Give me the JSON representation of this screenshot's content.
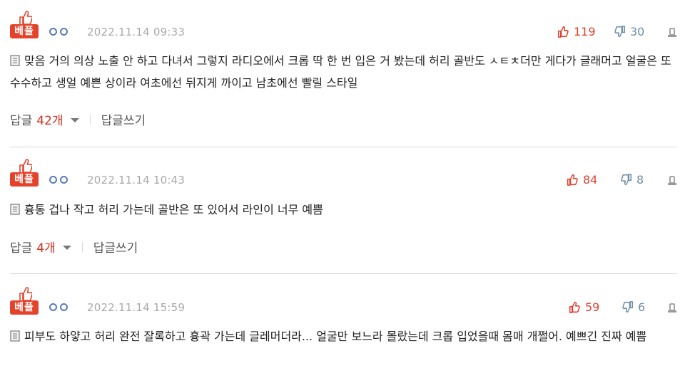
{
  "comments": [
    {
      "badge": "베플",
      "date": "2022.11.14 09:33",
      "up": "119",
      "down": "30",
      "text": "맞음 거의 의상 노출 안 하고 다녀서 그렇지 라디오에서 크롭 딱 한 번 입은 거 봤는데 허리 골반도 ㅅㅌㅊ더만 게다가 글래머고 얼굴은 또 수수하고 생얼 예쁜 상이라 여초에선 뒤지게 까이고 남초에선 빨릴 스타일",
      "reply_label": "답글",
      "reply_count": "42개",
      "write_reply": "답글쓰기"
    },
    {
      "badge": "베플",
      "date": "2022.11.14 10:43",
      "up": "84",
      "down": "8",
      "text": "흉통 겁나 작고 허리 가는데 골반은 또 있어서 라인이 너무 예쁨",
      "reply_label": "답글",
      "reply_count": "4개",
      "write_reply": "답글쓰기"
    },
    {
      "badge": "베플",
      "date": "2022.11.14 15:59",
      "up": "59",
      "down": "6",
      "text": "피부도 하얗고 허리 완전 잘록하고 흉곽 가는데 글레머더라... 얼굴만 보느라 몰랐는데 크롭 입었을때 몸매 개쩔어. 예쁘긴 진짜 예쁨"
    }
  ],
  "colors": {
    "accent_red": "#e5422b",
    "down_blue": "#6f8fa6",
    "user_blue": "#5a7ab8"
  },
  "icons": [
    "thumbs-up-icon",
    "thumbs-down-icon",
    "report-icon",
    "document-icon",
    "dropdown-caret-icon"
  ]
}
